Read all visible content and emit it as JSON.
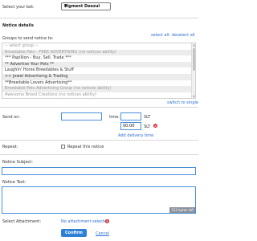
{
  "bot": {
    "label": "Select your bot:",
    "selected": "Figment Deezul"
  },
  "notice": {
    "section_title": "Notice details",
    "groups_label": "Groups to send notice to:",
    "select_all": "select all",
    "deselect_all": "deselect all",
    "groups": [
      {
        "label": "-- select group --",
        "disabled": true
      },
      {
        "label": "Breedable Pets - FREE ADVERTISING (no notices ability)",
        "disabled": true
      },
      {
        "label": "*** Papillion - Buy, Sell, Trade ***",
        "disabled": false
      },
      {
        "label": "** Advertise Your Pets **",
        "disabled": false
      },
      {
        "label": "Laughin' Horse Breedables & Stuff",
        "disabled": false
      },
      {
        "label": ">> Jewel Advertising & Trading",
        "disabled": false
      },
      {
        "label": "**Breedable Lovers Advertising**",
        "disabled": false
      },
      {
        "label": "Breedable Pets Advertising Group (no notices ability)",
        "disabled": true
      },
      {
        "label": "Awesome Breed Creations (no notices ability)",
        "disabled": true
      }
    ],
    "switch_link": "switch to single"
  },
  "send_on": {
    "label": "Send on:",
    "date_value": "",
    "time_label": "time:",
    "hour_value": "",
    "minute_value": "00:00",
    "tz": "SLT",
    "tz2": "SLT",
    "add_delivery": "Add delivery time"
  },
  "repeat": {
    "label": "Repeat:",
    "checkbox_label": "Repeat this notice"
  },
  "subject": {
    "label": "Notice Subject:",
    "value": ""
  },
  "text": {
    "label": "Notice Text:",
    "value": "",
    "counter": "512 bytes left"
  },
  "attachment": {
    "label": "Select Attachment:",
    "link": "No attachment selected"
  },
  "actions": {
    "confirm": "Confirm",
    "cancel": "Cancel"
  },
  "colors": {
    "accent": "#2d80d6",
    "link": "#2a6fd6",
    "error": "#d9232e"
  }
}
